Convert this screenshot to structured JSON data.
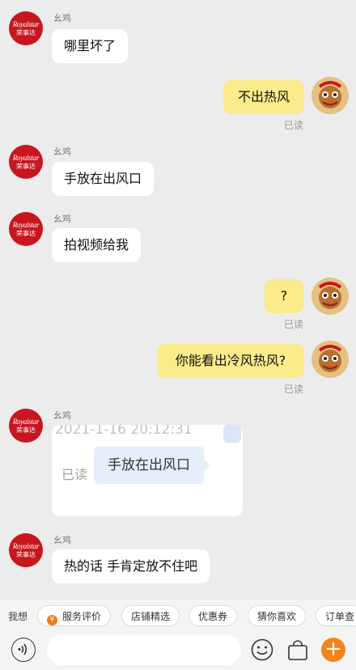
{
  "shop": {
    "avatar_line1": "Royalstar",
    "avatar_line2": "荣事达"
  },
  "messages": [
    {
      "side": "left",
      "sender": "幺鸡",
      "text": "哪里坏了"
    },
    {
      "side": "right",
      "text": "不出热风",
      "status": "已读"
    },
    {
      "side": "left",
      "sender": "幺鸡",
      "text": "手放在出风口"
    },
    {
      "side": "left",
      "sender": "幺鸡",
      "text": "拍视频给我"
    },
    {
      "side": "right",
      "text": "?",
      "status": "已读"
    },
    {
      "side": "right",
      "text": "你能看出冷风热风?",
      "status": "已读"
    },
    {
      "side": "left",
      "sender": "幺鸡",
      "type": "image",
      "image": {
        "timestamp": "2021-1-16 20:12:31",
        "read_label": "已读",
        "bubble_text": "手放在出风口"
      }
    },
    {
      "side": "left",
      "sender": "幺鸡",
      "text": "热的话 手肯定放不住吧"
    }
  ],
  "quickbar": {
    "label": "我想",
    "chips": [
      {
        "label": "服务评价",
        "icon": "coupon-icon"
      },
      {
        "label": "店铺精选"
      },
      {
        "label": "优惠券"
      },
      {
        "label": "猜你喜欢"
      },
      {
        "label": "订单查"
      }
    ]
  },
  "input": {
    "value": "",
    "placeholder": ""
  },
  "colors": {
    "accent": "#f3841b",
    "bubble_self": "#fbeb8a",
    "brand": "#c8161e"
  }
}
